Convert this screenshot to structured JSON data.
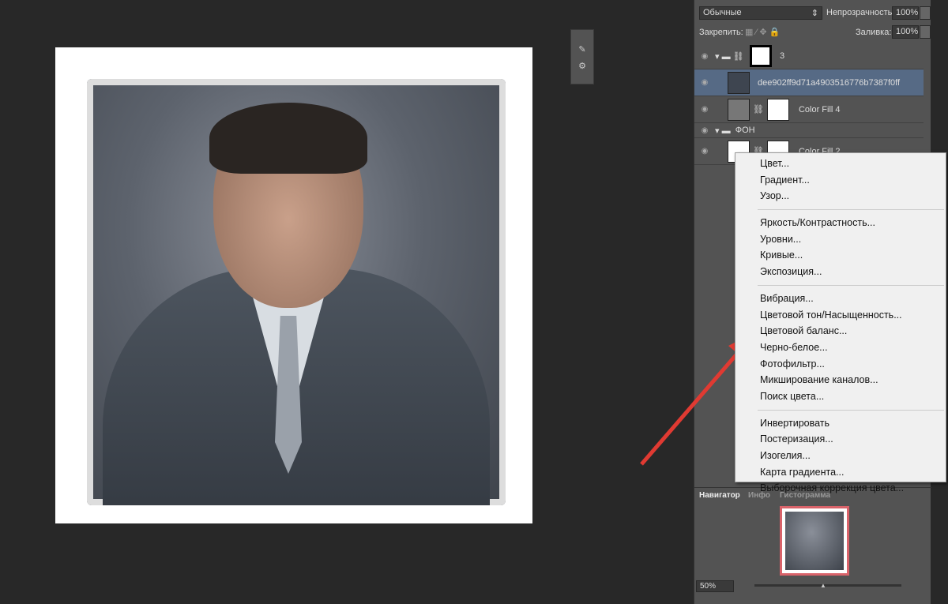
{
  "layers_panel": {
    "blend_mode": "Обычные",
    "opacity_label": "Непрозрачность:",
    "opacity_value": "100%",
    "lock_label": "Закрепить:",
    "fill_label": "Заливка:",
    "fill_value": "100%",
    "layers": [
      {
        "name": "3",
        "type": "group-mask"
      },
      {
        "name": "dee902ff9d71a4903516776b7387f0ff",
        "type": "smart-object",
        "selected": true
      },
      {
        "name": "Color Fill 4",
        "type": "fill"
      },
      {
        "name": "ФОН",
        "type": "group"
      },
      {
        "name": "Color Fill 2",
        "type": "fill"
      }
    ]
  },
  "context_menu": {
    "groups": [
      [
        "Цвет...",
        "Градиент...",
        "Узор..."
      ],
      [
        "Яркость/Контрастность...",
        "Уровни...",
        "Кривые...",
        "Экспозиция..."
      ],
      [
        "Вибрация...",
        "Цветовой тон/Насыщенность...",
        "Цветовой баланс...",
        "Черно-белое...",
        "Фотофильтр...",
        "Микширование каналов...",
        "Поиск цвета..."
      ],
      [
        "Инвертировать",
        "Постеризация...",
        "Изогелия...",
        "Карта градиента...",
        "Выборочная коррекция цвета..."
      ]
    ]
  },
  "navigator": {
    "tabs": [
      "Навигатор",
      "Инфо",
      "Гистограмма"
    ],
    "zoom": "50%"
  },
  "colors": {
    "arrow": "#e03a32",
    "selection": "#566a85",
    "panel": "#535353",
    "nav_frame": "#d9636a"
  }
}
